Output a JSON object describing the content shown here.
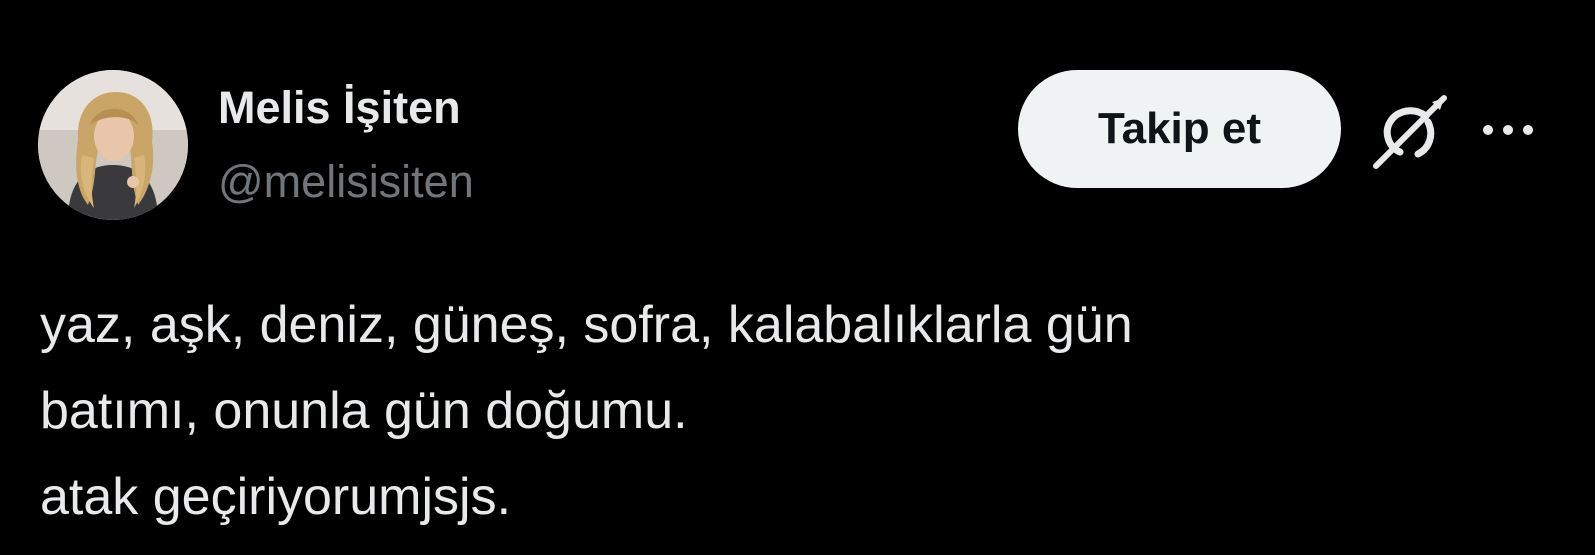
{
  "author": {
    "display_name": "Melis İşiten",
    "handle": "@melisisiten"
  },
  "actions": {
    "follow_label": "Takip et",
    "grok_icon": "grok-icon",
    "more_icon": "more-icon"
  },
  "tweet": {
    "lines": [
      "yaz, aşk, deniz, güneş, sofra, kalabalıklarla gün",
      "batımı, onunla gün doğumu.",
      "atak geçiriyorumjsjs."
    ]
  },
  "colors": {
    "background": "#000000",
    "primary_text": "#e7e9ea",
    "secondary_text": "#71767b",
    "follow_button_bg": "#eff3f4",
    "follow_button_text": "#0f1419"
  }
}
